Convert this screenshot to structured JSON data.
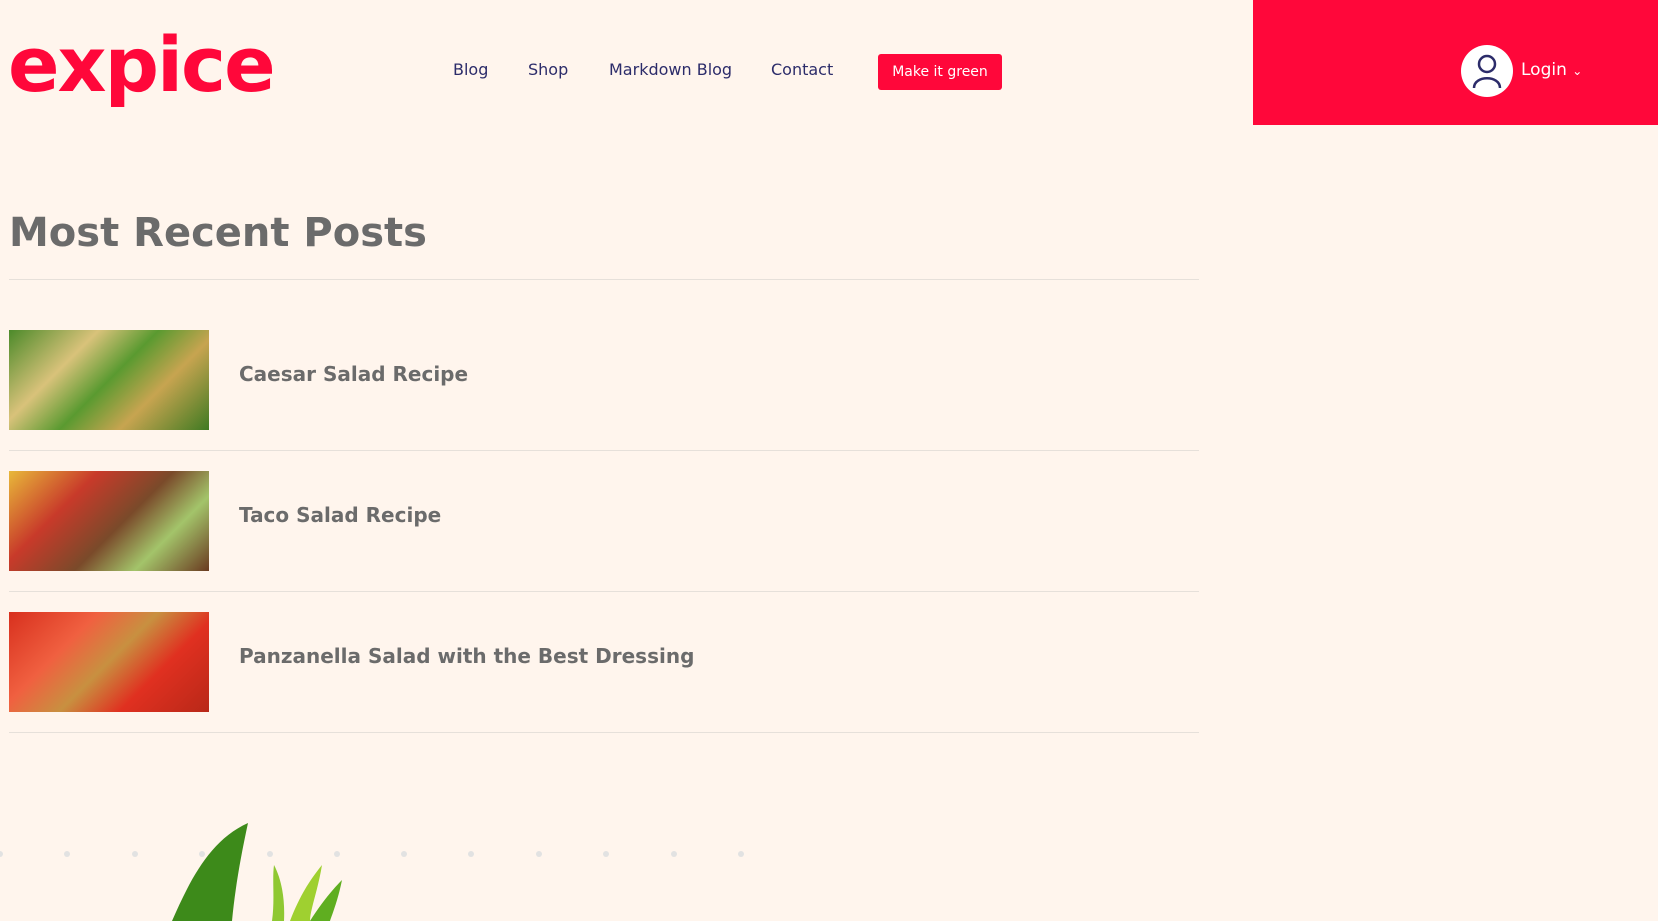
{
  "header": {
    "logo": "expice",
    "nav": [
      "Blog",
      "Shop",
      "Markdown Blog",
      "Contact"
    ],
    "cta": "Make it green",
    "login": "Login",
    "accent": "#ff073a"
  },
  "main": {
    "heading": "Most Recent Posts",
    "posts": [
      {
        "title": "Caesar Salad Recipe"
      },
      {
        "title": "Taco Salad Recipe"
      },
      {
        "title": "Panzanella Salad with the Best Dressing"
      }
    ]
  }
}
